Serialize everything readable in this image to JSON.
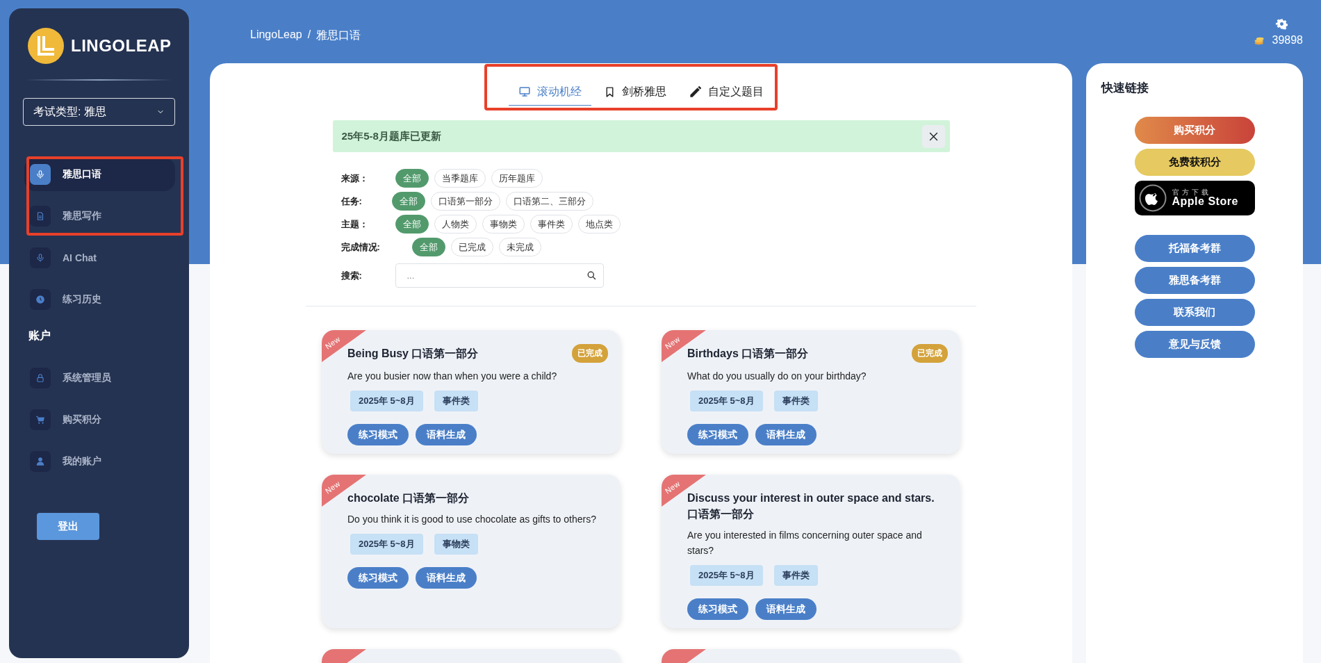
{
  "sidebar": {
    "logo_text": "LINGOLEAP",
    "exam_select": {
      "value": "考试类型: 雅思"
    },
    "nav_items": [
      {
        "label": "雅思口语",
        "selected": true
      },
      {
        "label": "雅思写作",
        "selected": false
      },
      {
        "label": "AI Chat",
        "selected": false
      },
      {
        "label": "练习历史",
        "selected": false
      }
    ],
    "account_heading": "账户",
    "account_items": [
      {
        "label": "系统管理员",
        "selected": false
      },
      {
        "label": "购买积分",
        "selected": false
      },
      {
        "label": "我的账户",
        "selected": false
      }
    ],
    "logout_button": "登出"
  },
  "breadcrumb": {
    "items": [
      "LingoLeap",
      "雅思口语"
    ],
    "separator": "/"
  },
  "points": "39898",
  "tabs": [
    {
      "label": "滚动机经",
      "selected": true
    },
    {
      "label": "剑桥雅思",
      "selected": false
    },
    {
      "label": "自定义题目",
      "selected": false
    }
  ],
  "alert": {
    "text": "25年5-8月题库已更新"
  },
  "filters": [
    {
      "label": "来源：",
      "options": [
        {
          "label": "全部",
          "selected": true
        },
        {
          "label": "当季题库",
          "selected": false
        },
        {
          "label": "历年题库",
          "selected": false
        }
      ]
    },
    {
      "label": "任务:",
      "options": [
        {
          "label": "全部",
          "selected": true
        },
        {
          "label": "口语第一部分",
          "selected": false
        },
        {
          "label": "口语第二、三部分",
          "selected": false
        }
      ]
    },
    {
      "label": "主题：",
      "options": [
        {
          "label": "全部",
          "selected": true
        },
        {
          "label": "人物类",
          "selected": false
        },
        {
          "label": "事物类",
          "selected": false
        },
        {
          "label": "事件类",
          "selected": false
        },
        {
          "label": "地点类",
          "selected": false
        }
      ]
    },
    {
      "label": "完成情况:",
      "options": [
        {
          "label": "全部",
          "selected": true
        },
        {
          "label": "已完成",
          "selected": false
        },
        {
          "label": "未完成",
          "selected": false
        }
      ]
    }
  ],
  "search": {
    "label": "搜索:",
    "placeholder": "..."
  },
  "cards": [
    {
      "new": true,
      "ribbon": "New",
      "title": "Being Busy 口语第一部分",
      "status": "已完成",
      "question": "Are you busier now than when you were a child?",
      "tags": [
        "2025年 5~8月",
        "事件类"
      ],
      "buttons": [
        "练习模式",
        "语料生成"
      ]
    },
    {
      "new": true,
      "ribbon": "New",
      "title": "Birthdays 口语第一部分",
      "status": "已完成",
      "question": "What do you usually do on your birthday?",
      "tags": [
        "2025年 5~8月",
        "事件类"
      ],
      "buttons": [
        "练习模式",
        "语料生成"
      ]
    },
    {
      "new": true,
      "ribbon": "New",
      "title": "chocolate 口语第一部分",
      "question": "Do you think it is good to use chocolate as gifts to others?",
      "tags": [
        "2025年 5~8月",
        "事物类"
      ],
      "buttons": [
        "练习模式",
        "语料生成"
      ]
    },
    {
      "new": true,
      "ribbon": "New",
      "title": "Discuss your interest in outer space and stars. 口语第一部分",
      "question": "Are you interested in films concerning outer space and stars?",
      "tags": [
        "2025年 5~8月",
        "事件类"
      ],
      "buttons": [
        "练习模式",
        "语料生成"
      ]
    },
    {
      "new": true
    },
    {
      "new": true
    }
  ],
  "quick_links": {
    "title": "快速链接",
    "buttons": [
      {
        "kind": "buy",
        "label": "购买积分"
      },
      {
        "kind": "free",
        "label": "免费获积分"
      },
      {
        "kind": "store",
        "small": "官方下载",
        "label": "Apple Store"
      },
      {
        "kind": "link",
        "label": "托福备考群"
      },
      {
        "kind": "link",
        "label": "雅思备考群"
      },
      {
        "kind": "link",
        "label": "联系我们"
      },
      {
        "kind": "link",
        "label": "意见与反馈"
      }
    ]
  }
}
